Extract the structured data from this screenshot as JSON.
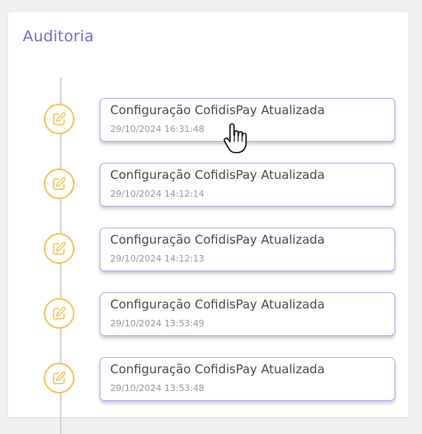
{
  "panel": {
    "title": "Auditoria"
  },
  "colors": {
    "title": "#7c67d8",
    "card_border": "#b7acf0",
    "marker_border": "#f5c55a",
    "timeline": "#d4d4d4"
  },
  "entries": [
    {
      "title": "Configuração CofidisPay Atualizada",
      "timestamp": "29/10/2024 16:31:48",
      "icon": "edit-icon"
    },
    {
      "title": "Configuração CofidisPay Atualizada",
      "timestamp": "29/10/2024 14:12:14",
      "icon": "edit-icon"
    },
    {
      "title": "Configuração CofidisPay Atualizada",
      "timestamp": "29/10/2024 14:12:13",
      "icon": "edit-icon"
    },
    {
      "title": "Configuração CofidisPay Atualizada",
      "timestamp": "29/10/2024 13:53:49",
      "icon": "edit-icon"
    },
    {
      "title": "Configuração CofidisPay Atualizada",
      "timestamp": "29/10/2024 13:53:48",
      "icon": "edit-icon"
    }
  ],
  "cursor": {
    "icon": "hand-pointer-icon"
  }
}
